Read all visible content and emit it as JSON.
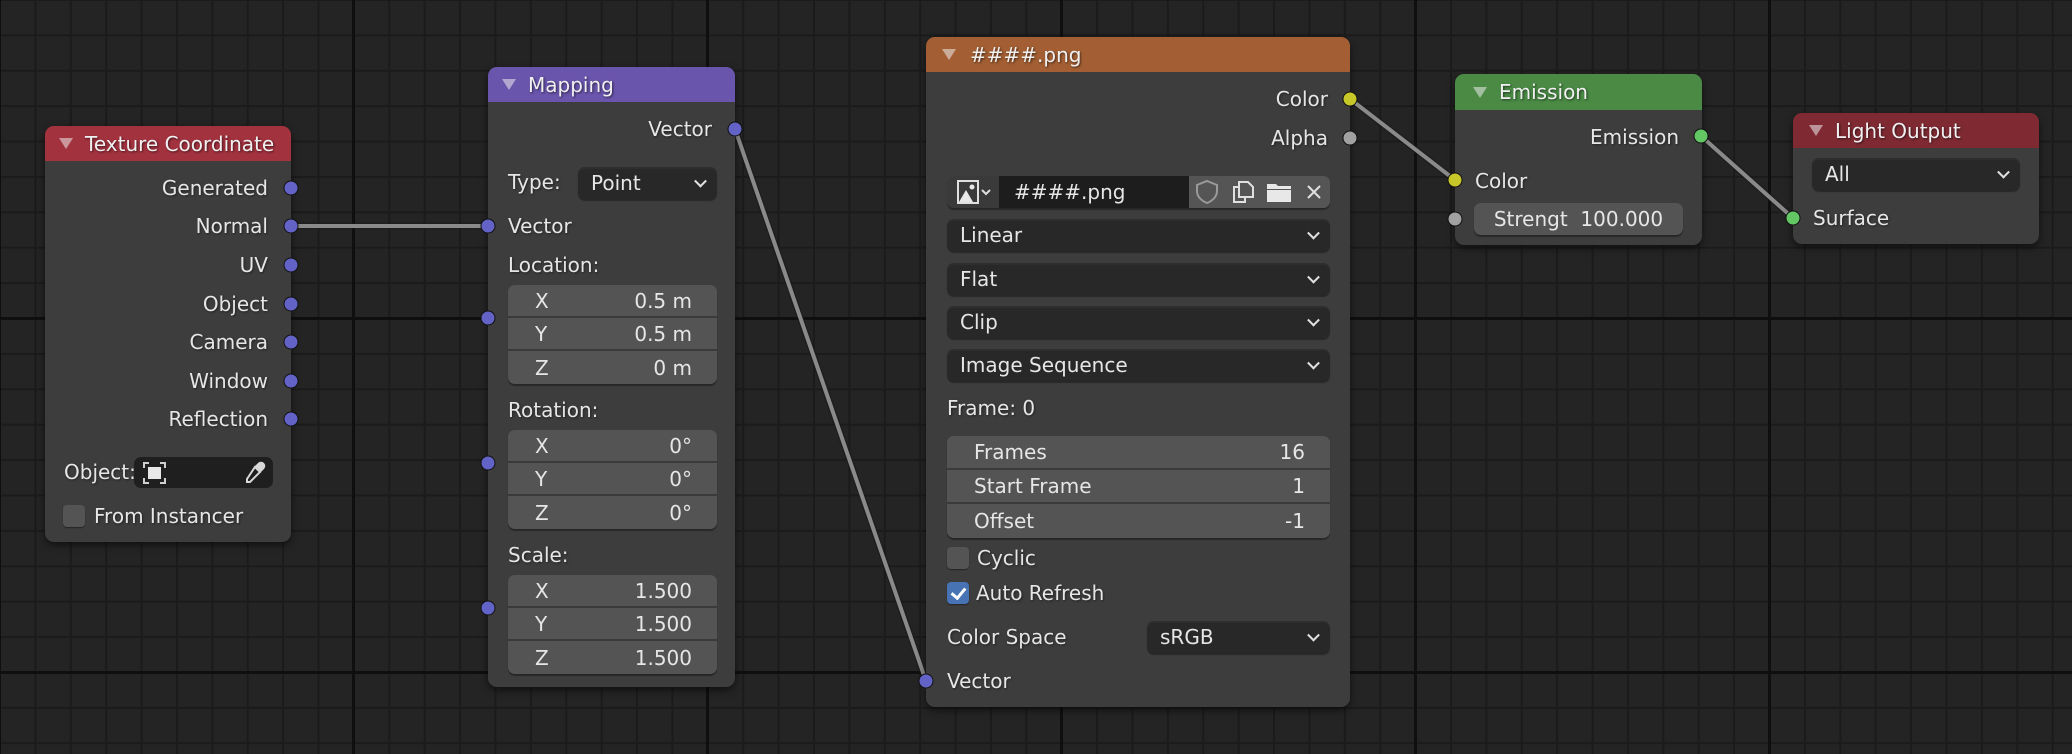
{
  "editor": "Shader Editor - Light node tree",
  "colors": {
    "texture_coordinate_header": "#a3323f",
    "mapping_header": "#6a55ad",
    "image_texture_header": "#a35f33",
    "emission_header": "#4a8a45",
    "light_output_header": "#7f2a33",
    "node_body": "#3d3d3d",
    "socket_vector": "#6363c7",
    "socket_color": "#c7c729",
    "socket_float": "#a1a1a1",
    "socket_shader": "#63c763",
    "checkbox_checked": "#4772b3"
  },
  "nodes": {
    "texture_coordinate": {
      "title": "Texture Coordinate",
      "outputs": [
        "Generated",
        "Normal",
        "UV",
        "Object",
        "Camera",
        "Window",
        "Reflection"
      ],
      "object_label": "Object:",
      "object_value": "",
      "object_icon": "object-icon",
      "eyedropper_icon": "eyedropper-icon",
      "from_instancer_label": "From Instancer",
      "from_instancer_checked": false
    },
    "mapping": {
      "title": "Mapping",
      "output": "Vector",
      "type_label": "Type:",
      "type_value": "Point",
      "input_vector": "Vector",
      "location": {
        "label": "Location:",
        "rows": [
          {
            "axis": "X",
            "value": "0.5 m"
          },
          {
            "axis": "Y",
            "value": "0.5 m"
          },
          {
            "axis": "Z",
            "value": "0 m"
          }
        ]
      },
      "rotation": {
        "label": "Rotation:",
        "rows": [
          {
            "axis": "X",
            "value": "0°"
          },
          {
            "axis": "Y",
            "value": "0°"
          },
          {
            "axis": "Z",
            "value": "0°"
          }
        ]
      },
      "scale": {
        "label": "Scale:",
        "rows": [
          {
            "axis": "X",
            "value": "1.500"
          },
          {
            "axis": "Y",
            "value": "1.500"
          },
          {
            "axis": "Z",
            "value": "1.500"
          }
        ]
      }
    },
    "image_texture": {
      "title": "####.png",
      "outputs": [
        "Color",
        "Alpha"
      ],
      "image_name": "####.png",
      "buttons": [
        "image-browse",
        "fake-user-shield",
        "duplicate",
        "open-folder",
        "unlink"
      ],
      "interpolation": "Linear",
      "projection": "Flat",
      "extension": "Clip",
      "source": "Image Sequence",
      "frame_label": "Frame: 0",
      "fields": [
        {
          "label": "Frames",
          "value": "16"
        },
        {
          "label": "Start Frame",
          "value": "1"
        },
        {
          "label": "Offset",
          "value": "-1"
        }
      ],
      "cyclic_label": "Cyclic",
      "cyclic_checked": false,
      "auto_refresh_label": "Auto Refresh",
      "auto_refresh_checked": true,
      "color_space_label": "Color Space",
      "color_space_value": "sRGB",
      "input_vector": "Vector"
    },
    "emission": {
      "title": "Emission",
      "output": "Emission",
      "input_color": "Color",
      "strength_label": "Strengt",
      "strength_value": "100.000"
    },
    "light_output": {
      "title": "Light Output",
      "target": "All",
      "input_surface": "Surface"
    }
  },
  "links": [
    {
      "from": "Texture Coordinate.Normal",
      "to": "Mapping.Vector"
    },
    {
      "from": "Mapping.Vector",
      "to": "####.png.Vector"
    },
    {
      "from": "####.png.Color",
      "to": "Emission.Color"
    },
    {
      "from": "Emission.Emission",
      "to": "Light Output.Surface"
    }
  ]
}
